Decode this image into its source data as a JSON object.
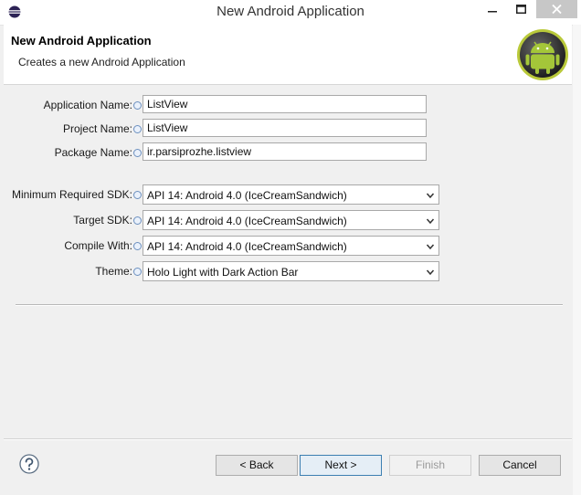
{
  "window": {
    "title": "New Android Application",
    "min_label": "",
    "max_label": "",
    "close_label": ""
  },
  "header": {
    "title": "New Android Application",
    "description": "Creates a new Android Application"
  },
  "form": {
    "app_name_label": "Application Name:",
    "app_name_value": "ListView",
    "project_name_label": "Project Name:",
    "project_name_value": "ListView",
    "package_name_label": "Package Name:",
    "package_name_value": "ir.parsiprozhe.listview",
    "min_sdk_label": "Minimum Required SDK:",
    "min_sdk_value": "API 14: Android 4.0 (IceCreamSandwich)",
    "target_sdk_label": "Target SDK:",
    "target_sdk_value": "API 14: Android 4.0 (IceCreamSandwich)",
    "compile_with_label": "Compile With:",
    "compile_with_value": "API 14: Android 4.0 (IceCreamSandwich)",
    "theme_label": "Theme:",
    "theme_value": "Holo Light with Dark Action Bar"
  },
  "buttons": {
    "back": "< Back",
    "next": "Next >",
    "finish": "Finish",
    "cancel": "Cancel"
  },
  "icons": {
    "app": "eclipse-icon",
    "logo": "android-logo-icon",
    "help": "help-icon",
    "info": "info-icon"
  },
  "colors": {
    "accent": "#3c7fb1",
    "android_green": "#a4c639"
  }
}
